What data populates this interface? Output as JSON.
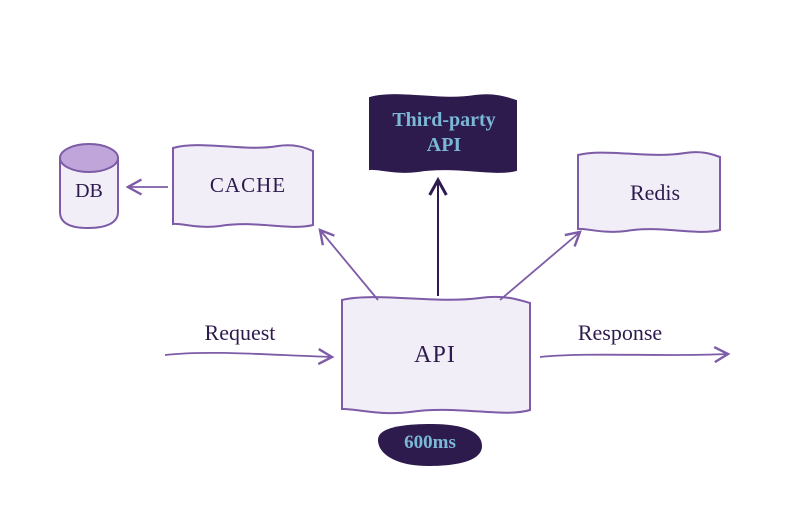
{
  "nodes": {
    "db": "DB",
    "cache": "CACHE",
    "third_party": "Third‑party API",
    "redis": "Redis",
    "api": "API",
    "latency": "600ms"
  },
  "edges": {
    "request": "Request",
    "response": "Response"
  },
  "colors": {
    "outline": "#7d5ba6",
    "outline_dark": "#2e1b4d",
    "fill_light": "#f2eef8",
    "fill_lid": "#bfa5d9",
    "fill_dark": "#2e1b4d",
    "text_dark": "#2e1b4d",
    "text_accent": "#7ab8d6"
  }
}
